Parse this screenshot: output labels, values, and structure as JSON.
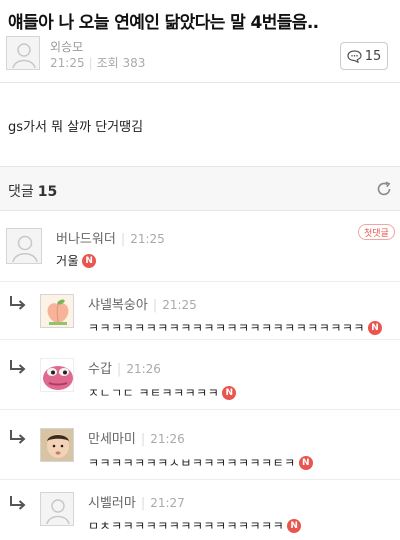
{
  "post": {
    "title": "얘들아 나 오늘 연예인 닮았다는 말 4번들음..",
    "author": "외승모",
    "time": "21:25",
    "views_label": "조회 383",
    "comment_count": "15",
    "body": "gs가서 뭐 살까 단거땡김"
  },
  "comments_header": {
    "label": "댓글",
    "count": "15"
  },
  "comments": [
    {
      "name": "버나드워더",
      "time": "21:25",
      "text": "거울",
      "badge": "첫댓글",
      "new_badge": "N",
      "avatar": "default-avatar"
    },
    {
      "name": "샤넬복숭아",
      "time": "21:25",
      "text": "ㅋㅋㅋㅋㅋㅋㅋㅋㅋㅋㅋㅋㅋㅋㅋㅋㅋㅋㅋㅋㅋㅋㅋㅋ",
      "new_badge": "N",
      "avatar": "peach-avatar"
    },
    {
      "name": "수갑",
      "time": "21:26",
      "text": "ㅈㄴㄱㄷ ㅋㅌㅋㅋㅋㅋㅋ",
      "new_badge": "N",
      "avatar": "pepe-frog-avatar"
    },
    {
      "name": "만세마미",
      "time": "21:26",
      "text": "ㅋㅋㅋㅋㅋㅋㅋㅅㅂㅋㅋㅋㅋㅋㅋㅋㅌㅋ",
      "new_badge": "N",
      "avatar": "baby-photo-avatar"
    },
    {
      "name": "시벨러마",
      "time": "21:27",
      "text": "ㅁㅊㅋㅋㅋㅋㅋㅋㅋㅋㅋㅋㅋㅋㅋㅋㅋ",
      "new_badge": "N",
      "avatar": "default-avatar"
    }
  ],
  "colors": {
    "accent": "#e8564f",
    "divider": "#e5e5e5",
    "header_bg": "#f7f7f7"
  }
}
